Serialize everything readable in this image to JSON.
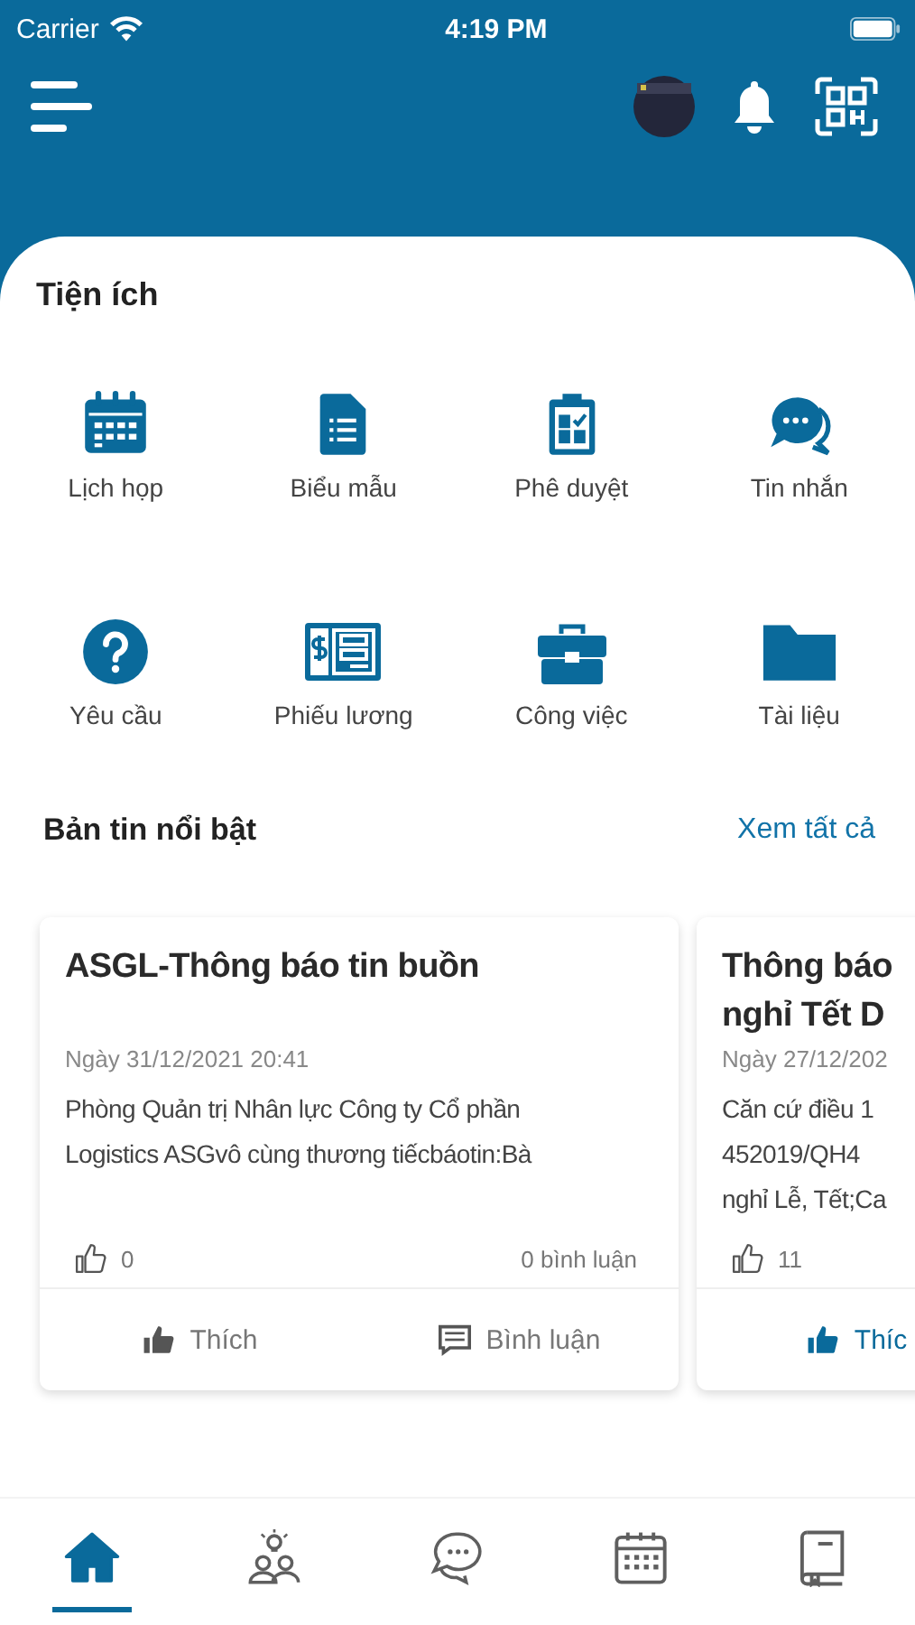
{
  "status_bar": {
    "carrier": "Carrier",
    "time": "4:19 PM"
  },
  "utilities": {
    "title": "Tiện ích",
    "items": [
      {
        "kind": "calendar",
        "label": "Lịch họp"
      },
      {
        "kind": "form",
        "label": "Biểu mẫu"
      },
      {
        "kind": "clipboard",
        "label": "Phê duyệt"
      },
      {
        "kind": "chat",
        "label": "Tin nhắn"
      },
      {
        "kind": "question",
        "label": "Yêu cầu"
      },
      {
        "kind": "payslip",
        "label": "Phiếu lương"
      },
      {
        "kind": "briefcase",
        "label": "Công việc"
      },
      {
        "kind": "folder",
        "label": "Tài liệu"
      }
    ]
  },
  "news": {
    "title": "Bản tin nổi bật",
    "see_all": "Xem tất cả",
    "cards": [
      {
        "title_lines": [
          "ASGL-Thông báo tin buồn"
        ],
        "date": "Ngày 31/12/2021 20:41",
        "body_lines": [
          "Phòng Quản trị Nhân lực Công ty Cổ phần",
          "Logistics ASGvô cùng thương tiếcbáotin:Bà"
        ],
        "likes": "0",
        "comments": "0 bình luận",
        "liked": false,
        "like_label": "Thích",
        "comment_label": "Bình luận"
      },
      {
        "title_lines": [
          "Thông báo",
          "nghỉ Tết D"
        ],
        "date": "Ngày 27/12/202",
        "body_lines": [
          "Căn cứ điều 1",
          "452019/QH4",
          "nghỉ Lễ, Tết;Ca"
        ],
        "likes": "11",
        "liked": true,
        "like_label": "Thíc"
      }
    ]
  },
  "bottom_nav": [
    {
      "kind": "home",
      "selected": true
    },
    {
      "kind": "team",
      "selected": false
    },
    {
      "kind": "chat",
      "selected": false
    },
    {
      "kind": "calendar",
      "selected": false
    },
    {
      "kind": "book",
      "selected": false
    }
  ]
}
